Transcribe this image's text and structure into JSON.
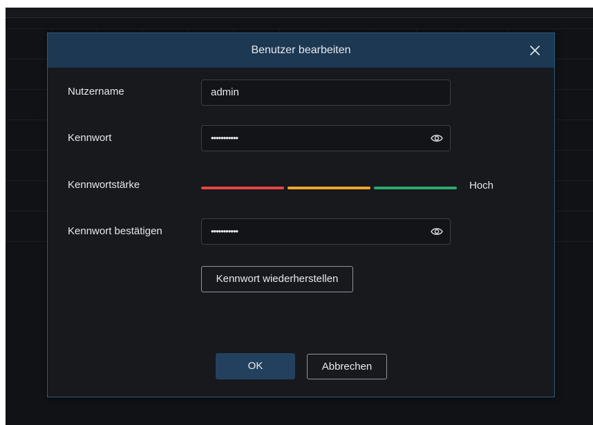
{
  "dialog": {
    "title": "Benutzer bearbeiten",
    "close_icon": "close-icon"
  },
  "form": {
    "username": {
      "label": "Nutzername",
      "value": "admin"
    },
    "password": {
      "label": "Kennwort",
      "value": "•••••••••••",
      "icon": "eye-icon"
    },
    "strength": {
      "label": "Kennwortstärke",
      "value": "Hoch",
      "segments": [
        "#e84343",
        "#f0a52b",
        "#2fa86f"
      ]
    },
    "confirm": {
      "label": "Kennwort bestätigen",
      "value": "•••••••••••",
      "icon": "eye-icon"
    }
  },
  "buttons": {
    "reset": "Kennwort wiederherstellen",
    "ok": "OK",
    "cancel": "Abbrechen"
  },
  "colors": {
    "header": "#1c3852",
    "accent": "#23415e"
  }
}
